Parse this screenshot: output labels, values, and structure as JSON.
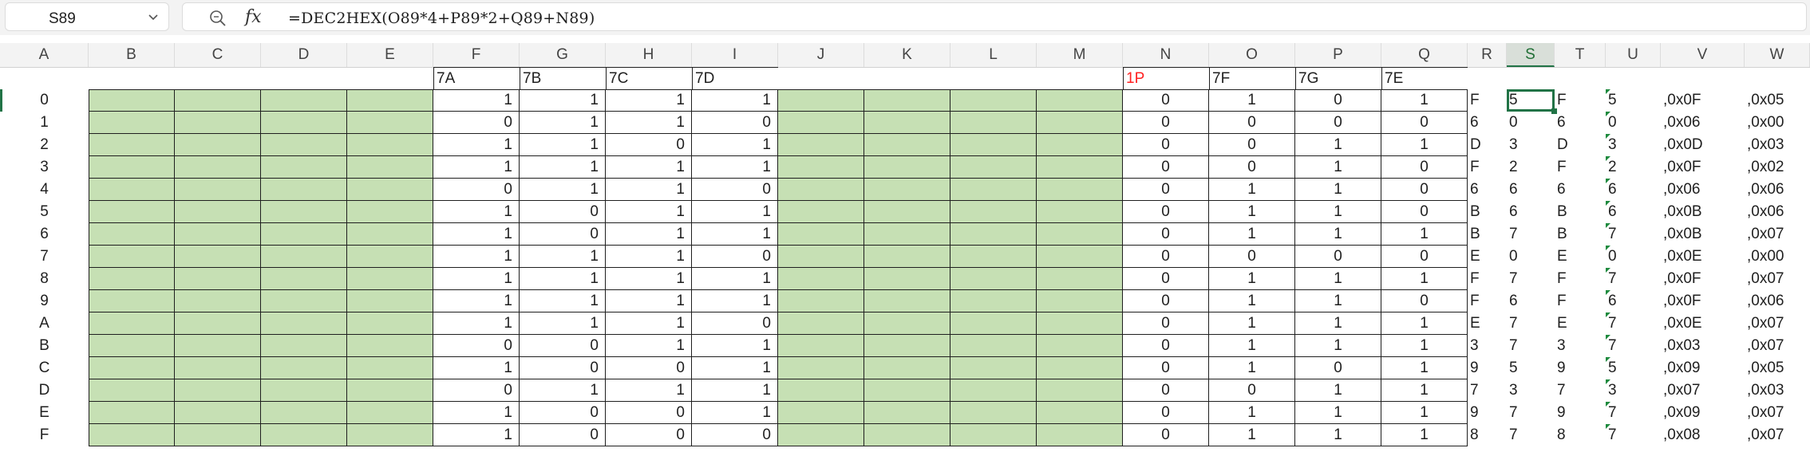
{
  "formula_bar": {
    "name_box": "S89",
    "fx_label": "fx",
    "formula": "=DEC2HEX(O89*4+P89*2+Q89+N89)"
  },
  "columns": [
    "A",
    "B",
    "C",
    "D",
    "E",
    "F",
    "G",
    "H",
    "I",
    "J",
    "K",
    "L",
    "M",
    "N",
    "O",
    "P",
    "Q",
    "R",
    "S",
    "T",
    "U",
    "V",
    "W"
  ],
  "selected_column": "S",
  "header_row": {
    "F": "7A",
    "G": "7B",
    "H": "7C",
    "I": "7D",
    "N": "1P",
    "O": "7F",
    "P": "7G",
    "Q": "7E"
  },
  "colors": {
    "fill_green": "#c6e0b4",
    "selection": "#217346",
    "highlight_text": "#ff2020"
  },
  "rows": [
    {
      "A": "0",
      "F": "1",
      "G": "1",
      "H": "1",
      "I": "1",
      "N": "0",
      "O": "1",
      "P": "0",
      "Q": "1",
      "R": "F",
      "S": "5",
      "T": "F",
      "U": "5",
      "V": ",0x0F",
      "W": ",0x05"
    },
    {
      "A": "1",
      "F": "0",
      "G": "1",
      "H": "1",
      "I": "0",
      "N": "0",
      "O": "0",
      "P": "0",
      "Q": "0",
      "R": "6",
      "S": "0",
      "T": "6",
      "U": "0",
      "V": ",0x06",
      "W": ",0x00"
    },
    {
      "A": "2",
      "F": "1",
      "G": "1",
      "H": "0",
      "I": "1",
      "N": "0",
      "O": "0",
      "P": "1",
      "Q": "1",
      "R": "D",
      "S": "3",
      "T": "D",
      "U": "3",
      "V": ",0x0D",
      "W": ",0x03"
    },
    {
      "A": "3",
      "F": "1",
      "G": "1",
      "H": "1",
      "I": "1",
      "N": "0",
      "O": "0",
      "P": "1",
      "Q": "0",
      "R": "F",
      "S": "2",
      "T": "F",
      "U": "2",
      "V": ",0x0F",
      "W": ",0x02"
    },
    {
      "A": "4",
      "F": "0",
      "G": "1",
      "H": "1",
      "I": "0",
      "N": "0",
      "O": "1",
      "P": "1",
      "Q": "0",
      "R": "6",
      "S": "6",
      "T": "6",
      "U": "6",
      "V": ",0x06",
      "W": ",0x06"
    },
    {
      "A": "5",
      "F": "1",
      "G": "0",
      "H": "1",
      "I": "1",
      "N": "0",
      "O": "1",
      "P": "1",
      "Q": "0",
      "R": "B",
      "S": "6",
      "T": "B",
      "U": "6",
      "V": ",0x0B",
      "W": ",0x06"
    },
    {
      "A": "6",
      "F": "1",
      "G": "0",
      "H": "1",
      "I": "1",
      "N": "0",
      "O": "1",
      "P": "1",
      "Q": "1",
      "R": "B",
      "S": "7",
      "T": "B",
      "U": "7",
      "V": ",0x0B",
      "W": ",0x07"
    },
    {
      "A": "7",
      "F": "1",
      "G": "1",
      "H": "1",
      "I": "0",
      "N": "0",
      "O": "0",
      "P": "0",
      "Q": "0",
      "R": "E",
      "S": "0",
      "T": "E",
      "U": "0",
      "V": ",0x0E",
      "W": ",0x00"
    },
    {
      "A": "8",
      "F": "1",
      "G": "1",
      "H": "1",
      "I": "1",
      "N": "0",
      "O": "1",
      "P": "1",
      "Q": "1",
      "R": "F",
      "S": "7",
      "T": "F",
      "U": "7",
      "V": ",0x0F",
      "W": ",0x07"
    },
    {
      "A": "9",
      "F": "1",
      "G": "1",
      "H": "1",
      "I": "1",
      "N": "0",
      "O": "1",
      "P": "1",
      "Q": "0",
      "R": "F",
      "S": "6",
      "T": "F",
      "U": "6",
      "V": ",0x0F",
      "W": ",0x06"
    },
    {
      "A": "A",
      "F": "1",
      "G": "1",
      "H": "1",
      "I": "0",
      "N": "0",
      "O": "1",
      "P": "1",
      "Q": "1",
      "R": "E",
      "S": "7",
      "T": "E",
      "U": "7",
      "V": ",0x0E",
      "W": ",0x07"
    },
    {
      "A": "B",
      "F": "0",
      "G": "0",
      "H": "1",
      "I": "1",
      "N": "0",
      "O": "1",
      "P": "1",
      "Q": "1",
      "R": "3",
      "S": "7",
      "T": "3",
      "U": "7",
      "V": ",0x03",
      "W": ",0x07"
    },
    {
      "A": "C",
      "F": "1",
      "G": "0",
      "H": "0",
      "I": "1",
      "N": "0",
      "O": "1",
      "P": "0",
      "Q": "1",
      "R": "9",
      "S": "5",
      "T": "9",
      "U": "5",
      "V": ",0x09",
      "W": ",0x05"
    },
    {
      "A": "D",
      "F": "0",
      "G": "1",
      "H": "1",
      "I": "1",
      "N": "0",
      "O": "0",
      "P": "1",
      "Q": "1",
      "R": "7",
      "S": "3",
      "T": "7",
      "U": "3",
      "V": ",0x07",
      "W": ",0x03"
    },
    {
      "A": "E",
      "F": "1",
      "G": "0",
      "H": "0",
      "I": "1",
      "N": "0",
      "O": "1",
      "P": "1",
      "Q": "1",
      "R": "9",
      "S": "7",
      "T": "9",
      "U": "7",
      "V": ",0x09",
      "W": ",0x07"
    },
    {
      "A": "F",
      "F": "1",
      "G": "0",
      "H": "0",
      "I": "0",
      "N": "0",
      "O": "1",
      "P": "1",
      "Q": "1",
      "R": "8",
      "S": "7",
      "T": "8",
      "U": "7",
      "V": ",0x08",
      "W": ",0x07"
    }
  ]
}
